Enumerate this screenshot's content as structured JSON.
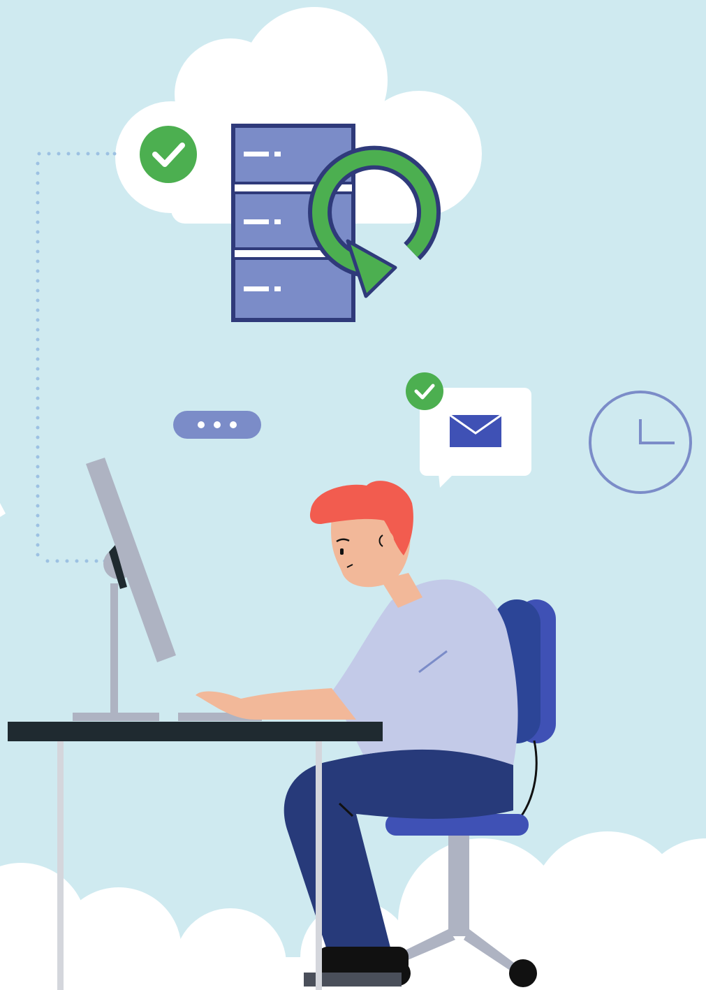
{
  "scene": {
    "description_free": true,
    "icons": {
      "status_badges": [
        "check-icon",
        "check-icon"
      ],
      "server": "server-stack-icon",
      "sync": "sync-arrow-icon",
      "message": "envelope-icon",
      "clock": "clock-icon",
      "typing": "ellipsis-icon"
    },
    "colors": {
      "sky": "#cfeaf0",
      "cloud": "#ffffff",
      "success": "#4caf50",
      "server_fill": "#7b8cc8",
      "server_outline": "#2f3a7a",
      "accent_blue": "#2c4597",
      "envelope": "#3f51b5",
      "clock_stroke": "#7b8cc8",
      "dots": "#9cc1e2",
      "hair": "#f25c4f",
      "skin": "#f2b899",
      "shirt": "#c3cae8",
      "pants": "#273a7a",
      "desk_top": "#1f2a30",
      "metal": "#aeb3c2"
    }
  }
}
